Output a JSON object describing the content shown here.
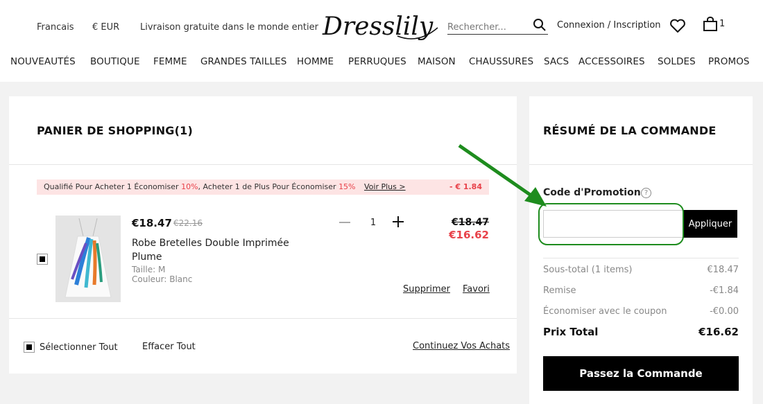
{
  "header": {
    "language": "Francais",
    "currency": "€ EUR",
    "shipping_note": "Livraison gratuite dans le monde entier",
    "logo_text": "Dresslily",
    "search_placeholder": "Rechercher...",
    "login_label": "Connexion / Inscription",
    "cart_count": "1"
  },
  "nav": [
    "NOUVEAUTÉS",
    "BOUTIQUE",
    "FEMME",
    "GRANDES TAILLES",
    "HOMME",
    "PERRUQUES",
    "MAISON",
    "CHAUSSURES",
    "SACS",
    "ACCESSOIRES",
    "SOLDES",
    "PROMOS"
  ],
  "cart": {
    "title": "PANIER DE SHOPPING(1)",
    "promo_prefix": "Qualifié Pour Acheter 1 Économiser ",
    "promo_pct1": "10%",
    "promo_mid": ", Acheter 1 de Plus Pour Économiser ",
    "promo_pct2": "15%",
    "promo_more": "Voir Plus >",
    "promo_discount": "- € 1.84",
    "item": {
      "price_now": "€18.47",
      "price_old": "€22.16",
      "name": "Robe Bretelles Double Imprimée Plume",
      "size": "Taille: M",
      "color": "Couleur: Blanc",
      "quantity": "1",
      "total_old": "€18.47",
      "total_new": "€16.62",
      "delete_label": "Supprimer",
      "favorite_label": "Favori"
    },
    "select_all": "Sélectionner Tout",
    "clear_all": "Effacer Tout",
    "continue": "Continuez Vos Achats"
  },
  "summary": {
    "title": "RÉSUMÉ DE LA COMMANDE",
    "promo_label": "Code d'Promotion",
    "help_glyph": "?",
    "promo_value": "",
    "apply_label": "Appliquer",
    "subtotal_label": "Sous-total (1 items)",
    "subtotal_value": "€18.47",
    "discount_label": "Remise",
    "discount_value": "-€1.84",
    "coupon_label": "Économiser avec le coupon",
    "coupon_value": "-€0.00",
    "total_label": "Prix Total",
    "total_value": "€16.62",
    "checkout_label": "Passez la Commande"
  },
  "colors": {
    "accent_red": "#e8424a",
    "promo_bg": "#fde4e4",
    "annotation_green": "#1e8c1e"
  }
}
